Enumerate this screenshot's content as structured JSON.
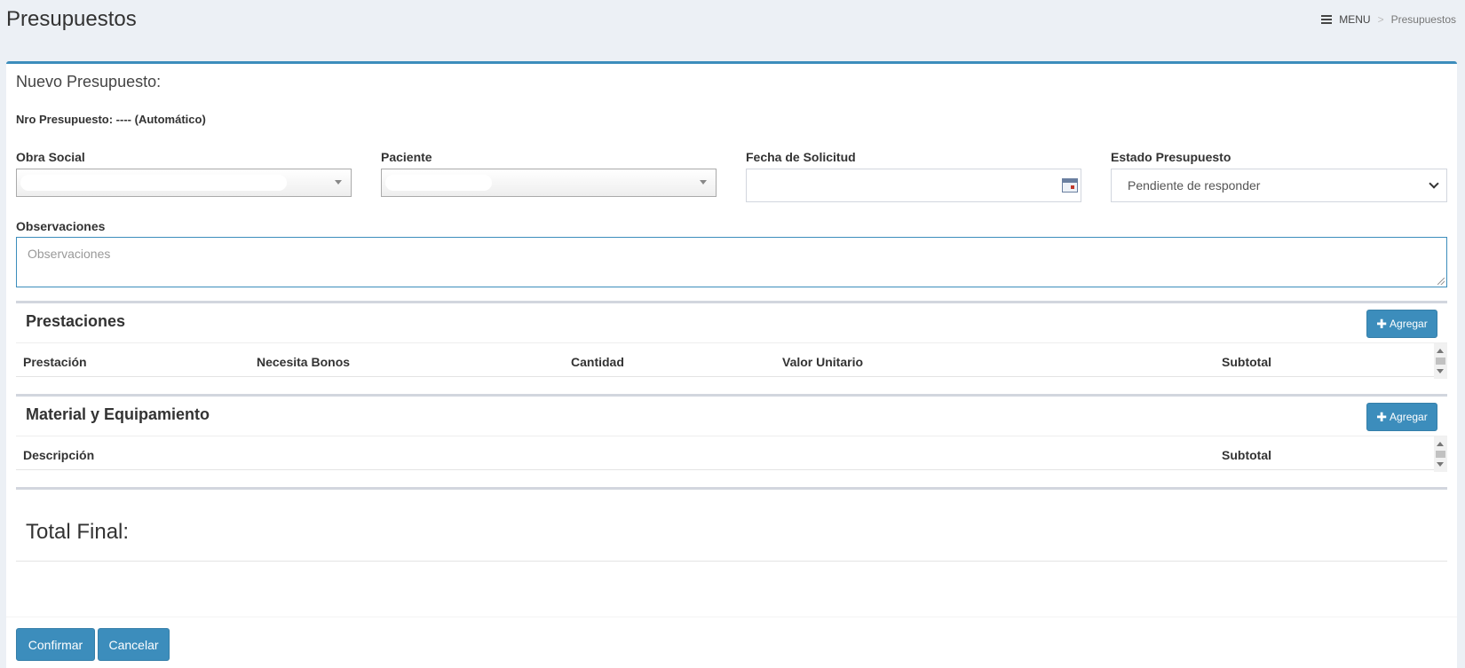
{
  "header": {
    "title": "Presupuestos",
    "breadcrumb": {
      "menu_label": "MENU",
      "separator": ">",
      "current": "Presupuestos"
    }
  },
  "form": {
    "box_title": "Nuevo Presupuesto:",
    "nro_presupuesto": "Nro Presupuesto: ---- (Automático)",
    "obra_social": {
      "label": "Obra Social",
      "value": ""
    },
    "paciente": {
      "label": "Paciente",
      "value": ""
    },
    "fecha_solicitud": {
      "label": "Fecha de Solicitud",
      "value": ""
    },
    "estado_presupuesto": {
      "label": "Estado Presupuesto",
      "selected": "Pendiente de responder"
    },
    "observaciones": {
      "label": "Observaciones",
      "placeholder": "Observaciones",
      "value": ""
    }
  },
  "prestaciones": {
    "title": "Prestaciones",
    "add_label": "Agregar",
    "columns": [
      "Prestación",
      "Necesita Bonos",
      "Cantidad",
      "Valor Unitario",
      "Subtotal"
    ],
    "rows": []
  },
  "material": {
    "title": "Material y Equipamiento",
    "add_label": "Agregar",
    "columns": [
      "Descripción",
      "Subtotal"
    ],
    "rows": []
  },
  "total": {
    "label": "Total Final:",
    "value": ""
  },
  "footer": {
    "confirm_label": "Confirmar",
    "cancel_label": "Cancelar"
  },
  "colors": {
    "accent": "#3c8dbc",
    "background": "#ecf0f5"
  },
  "icons": {
    "menu": "bars-icon",
    "calendar": "calendar-icon",
    "add": "plus-icon"
  }
}
